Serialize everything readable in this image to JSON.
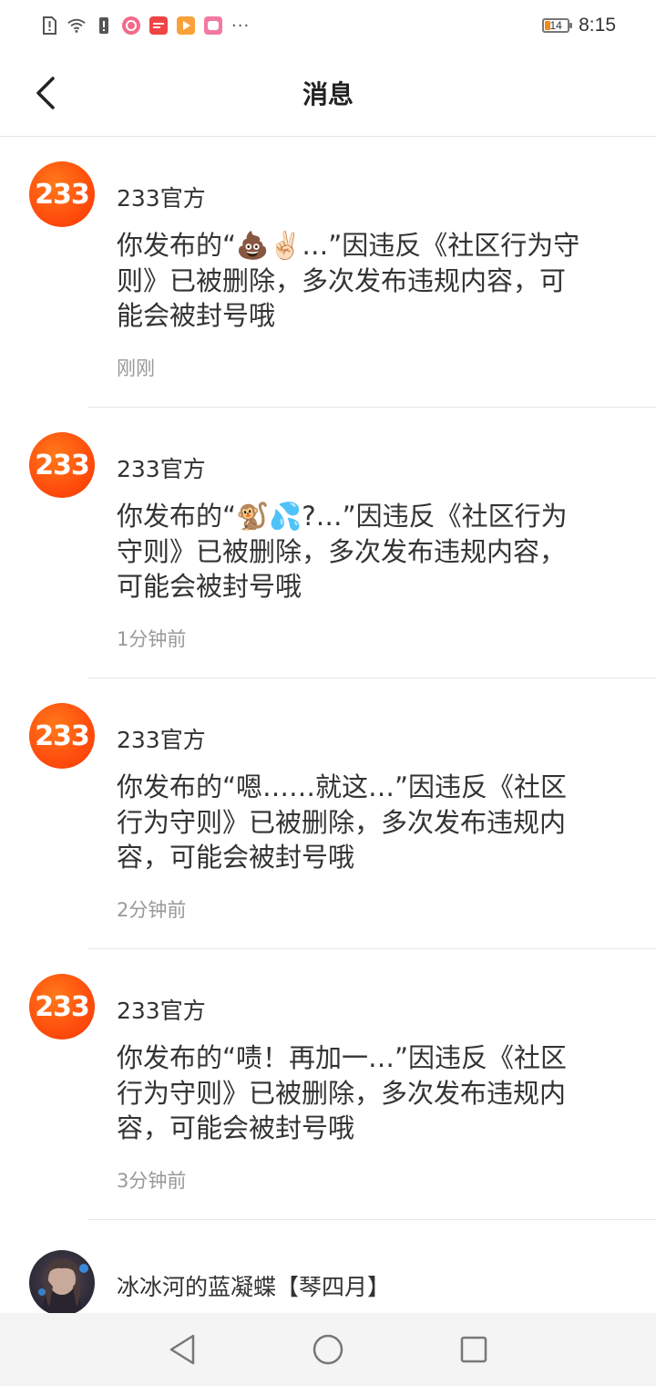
{
  "status_bar": {
    "time": "8:15",
    "battery": "14",
    "more": "···"
  },
  "header": {
    "title": "消息"
  },
  "messages": [
    {
      "sender": "233官方",
      "avatar_text": "233",
      "text": "你发布的“💩✌🏻…”因违反《社区行为守则》已被删除，多次发布违规内容，可能会被封号哦",
      "time": "刚刚"
    },
    {
      "sender": "233官方",
      "avatar_text": "233",
      "text": "你发布的“🐒💦?…”因违反《社区行为守则》已被删除，多次发布违规内容，可能会被封号哦",
      "time": "1分钟前"
    },
    {
      "sender": "233官方",
      "avatar_text": "233",
      "text": "你发布的“嗯……就这…”因违反《社区行为守则》已被删除，多次发布违规内容，可能会被封号哦",
      "time": "2分钟前"
    },
    {
      "sender": "233官方",
      "avatar_text": "233",
      "text": "你发布的“啧！再加一…”因违反《社区行为守则》已被删除，多次发布违规内容，可能会被封号哦",
      "time": "3分钟前"
    }
  ],
  "last_message": {
    "sender": "冰冰河的蓝凝蝶【琴四月】"
  },
  "colors": {
    "brand": "#ff5a14",
    "secondary_text": "#999999",
    "nav_background": "#f4f4f4"
  }
}
